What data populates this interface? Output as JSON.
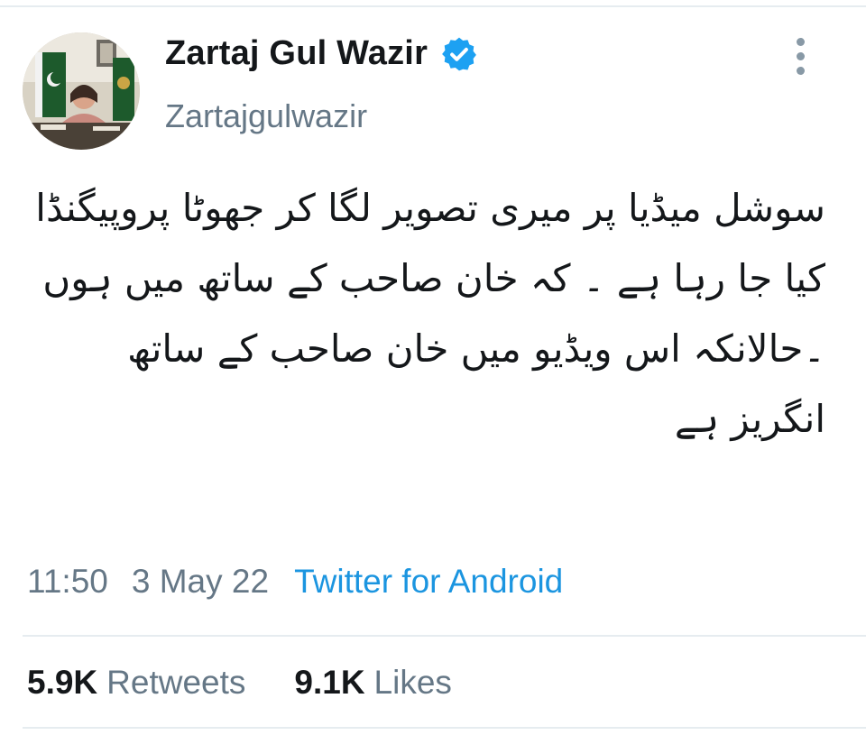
{
  "tweet": {
    "author_name": "Zartaj Gul Wazir",
    "author_handle": "Zartajgulwazir",
    "text": "سوشل میڈیا پر میری تصویر لگا کر جھوٹا پروپیگنڈا کیا جا رہا ہے ۔ کہ خان صاحب کے ساتھ میں ہوں ۔حالانکہ اس ویڈیو میں خان صاحب کے ساتھ انگریز ہے",
    "time": "11:50",
    "date": "3 May 22",
    "source": "Twitter for Android"
  },
  "stats": {
    "retweets_count": "5.9K",
    "retweets_label": "Retweets",
    "likes_count": "9.1K",
    "likes_label": "Likes"
  },
  "icons": {
    "verified": "verified-badge-icon",
    "more": "more-vertical-icon"
  },
  "colors": {
    "link": "#1b95e0",
    "verified": "#1da1f2",
    "secondary_text": "#657786",
    "divider": "#e6ecf0"
  }
}
